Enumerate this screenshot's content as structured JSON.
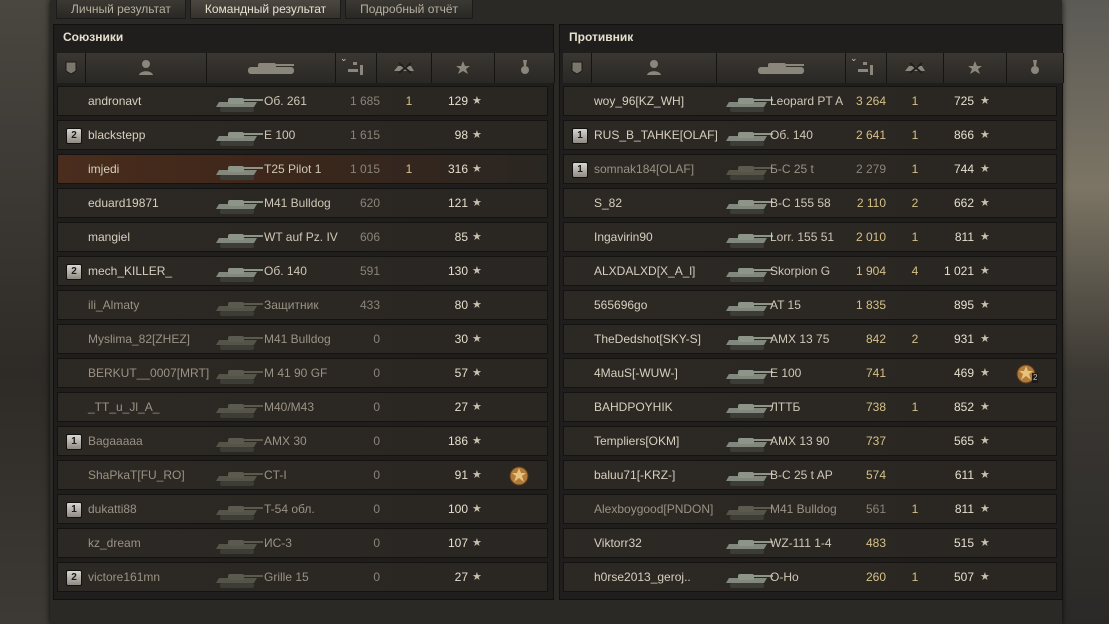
{
  "tabs": [
    "Личный результат",
    "Командный результат",
    "Подробный отчёт"
  ],
  "active_tab": 1,
  "allies": {
    "title": "Союзники",
    "rows": [
      {
        "player": "andronavt",
        "badge": "",
        "tank": "Об. 261",
        "damage": "1 685",
        "kills": "1",
        "xp": "129",
        "dim": false,
        "hl": false,
        "medal": ""
      },
      {
        "player": "blackstepp",
        "badge": "2",
        "tank": "E 100",
        "damage": "1 615",
        "kills": "",
        "xp": "98",
        "dim": false,
        "hl": false,
        "medal": ""
      },
      {
        "player": "imjedi",
        "badge": "",
        "tank": "T25 Pilot 1",
        "damage": "1 015",
        "kills": "1",
        "xp": "316",
        "dim": false,
        "hl": true,
        "medal": ""
      },
      {
        "player": "eduard19871",
        "badge": "",
        "tank": "M41 Bulldog",
        "damage": "620",
        "kills": "",
        "xp": "121",
        "dim": false,
        "hl": false,
        "medal": ""
      },
      {
        "player": "mangiel",
        "badge": "",
        "tank": "WT auf Pz. IV",
        "damage": "606",
        "kills": "",
        "xp": "85",
        "dim": false,
        "hl": false,
        "medal": ""
      },
      {
        "player": "mech_KILLER_",
        "badge": "2",
        "tank": "Об. 140",
        "damage": "591",
        "kills": "",
        "xp": "130",
        "dim": false,
        "hl": false,
        "medal": ""
      },
      {
        "player": "ili_Almaty",
        "badge": "",
        "tank": "Защитник",
        "damage": "433",
        "kills": "",
        "xp": "80",
        "dim": true,
        "hl": false,
        "medal": ""
      },
      {
        "player": "Myslima_82[ZHEZ]",
        "badge": "",
        "tank": "M41 Bulldog",
        "damage": "0",
        "kills": "",
        "xp": "30",
        "dim": true,
        "hl": false,
        "medal": ""
      },
      {
        "player": "BERKUT__0007[MRT]",
        "badge": "",
        "tank": "M 41 90 GF",
        "damage": "0",
        "kills": "",
        "xp": "57",
        "dim": true,
        "hl": false,
        "medal": ""
      },
      {
        "player": "_TT_u_Jl_A_",
        "badge": "",
        "tank": "M40/M43",
        "damage": "0",
        "kills": "",
        "xp": "27",
        "dim": true,
        "hl": false,
        "medal": ""
      },
      {
        "player": "Bagaaaaa",
        "badge": "1",
        "tank": "AMX 30",
        "damage": "0",
        "kills": "",
        "xp": "186",
        "dim": true,
        "hl": false,
        "medal": ""
      },
      {
        "player": "ShaPkaT[FU_RO]",
        "badge": "",
        "tank": "CT-I",
        "damage": "0",
        "kills": "",
        "xp": "91",
        "dim": true,
        "hl": false,
        "medal": "medal"
      },
      {
        "player": "dukatti88",
        "badge": "1",
        "tank": "T-54 обл.",
        "damage": "0",
        "kills": "",
        "xp": "100",
        "dim": true,
        "hl": false,
        "medal": ""
      },
      {
        "player": "kz_dream",
        "badge": "",
        "tank": "ИС-3",
        "damage": "0",
        "kills": "",
        "xp": "107",
        "dim": true,
        "hl": false,
        "medal": ""
      },
      {
        "player": "victore161mn",
        "badge": "2",
        "tank": "Grille 15",
        "damage": "0",
        "kills": "",
        "xp": "27",
        "dim": true,
        "hl": false,
        "medal": ""
      }
    ]
  },
  "enemies": {
    "title": "Противник",
    "rows": [
      {
        "player": "woy_96[KZ_WH]",
        "badge": "",
        "tank": "Leopard PT A",
        "damage": "3 264",
        "kills": "1",
        "xp": "725",
        "dim": false,
        "hl": false,
        "medal": ""
      },
      {
        "player": "RUS_B_TAHKE[OLAF]",
        "badge": "1",
        "tank": "Об. 140",
        "damage": "2 641",
        "kills": "1",
        "xp": "866",
        "dim": false,
        "hl": false,
        "medal": ""
      },
      {
        "player": "somnak184[OLAF]",
        "badge": "1",
        "tank": "Б-С 25 t",
        "damage": "2 279",
        "kills": "1",
        "xp": "744",
        "dim": true,
        "hl": false,
        "medal": ""
      },
      {
        "player": "S_82",
        "badge": "",
        "tank": "B-C 155 58",
        "damage": "2 110",
        "kills": "2",
        "xp": "662",
        "dim": false,
        "hl": false,
        "medal": ""
      },
      {
        "player": "Ingavirin90",
        "badge": "",
        "tank": "Lorr. 155 51",
        "damage": "2 010",
        "kills": "1",
        "xp": "811",
        "dim": false,
        "hl": false,
        "medal": ""
      },
      {
        "player": "ALXDALXD[X_A_l]",
        "badge": "",
        "tank": "Skorpion G",
        "damage": "1 904",
        "kills": "4",
        "xp": "1 021",
        "dim": false,
        "hl": false,
        "medal": ""
      },
      {
        "player": "565696go",
        "badge": "",
        "tank": "AT 15",
        "damage": "1 835",
        "kills": "",
        "xp": "895",
        "dim": false,
        "hl": false,
        "medal": ""
      },
      {
        "player": "TheDedshot[SKY-S]",
        "badge": "",
        "tank": "AMX 13 75",
        "damage": "842",
        "kills": "2",
        "xp": "931",
        "dim": false,
        "hl": false,
        "medal": ""
      },
      {
        "player": "4MauS[-WUW-]",
        "badge": "",
        "tank": "E 100",
        "damage": "741",
        "kills": "",
        "xp": "469",
        "dim": false,
        "hl": false,
        "medal": "medal",
        "medal_count": "2"
      },
      {
        "player": "BAHDPOYHIK",
        "badge": "",
        "tank": "ЛТТБ",
        "damage": "738",
        "kills": "1",
        "xp": "852",
        "dim": false,
        "hl": false,
        "medal": ""
      },
      {
        "player": "Templiers[OKM]",
        "badge": "",
        "tank": "AMX 13 90",
        "damage": "737",
        "kills": "",
        "xp": "565",
        "dim": false,
        "hl": false,
        "medal": ""
      },
      {
        "player": "baluu71[-KRZ-]",
        "badge": "",
        "tank": "B-C 25 t AP",
        "damage": "574",
        "kills": "",
        "xp": "611",
        "dim": false,
        "hl": false,
        "medal": ""
      },
      {
        "player": "Alexboygood[PNDON]",
        "badge": "",
        "tank": "M41 Bulldog",
        "damage": "561",
        "kills": "1",
        "xp": "811",
        "dim": true,
        "hl": false,
        "medal": ""
      },
      {
        "player": "Viktorr32",
        "badge": "",
        "tank": "WZ-111 1-4",
        "damage": "483",
        "kills": "",
        "xp": "515",
        "dim": false,
        "hl": false,
        "medal": ""
      },
      {
        "player": "h0rse2013_geroj..",
        "badge": "",
        "tank": "O-Ho",
        "damage": "260",
        "kills": "1",
        "xp": "507",
        "dim": false,
        "hl": false,
        "medal": ""
      }
    ]
  },
  "star_glyph": "★",
  "colors": {
    "accent": "#d6c189",
    "highlight_row": "#4a2d1d"
  }
}
